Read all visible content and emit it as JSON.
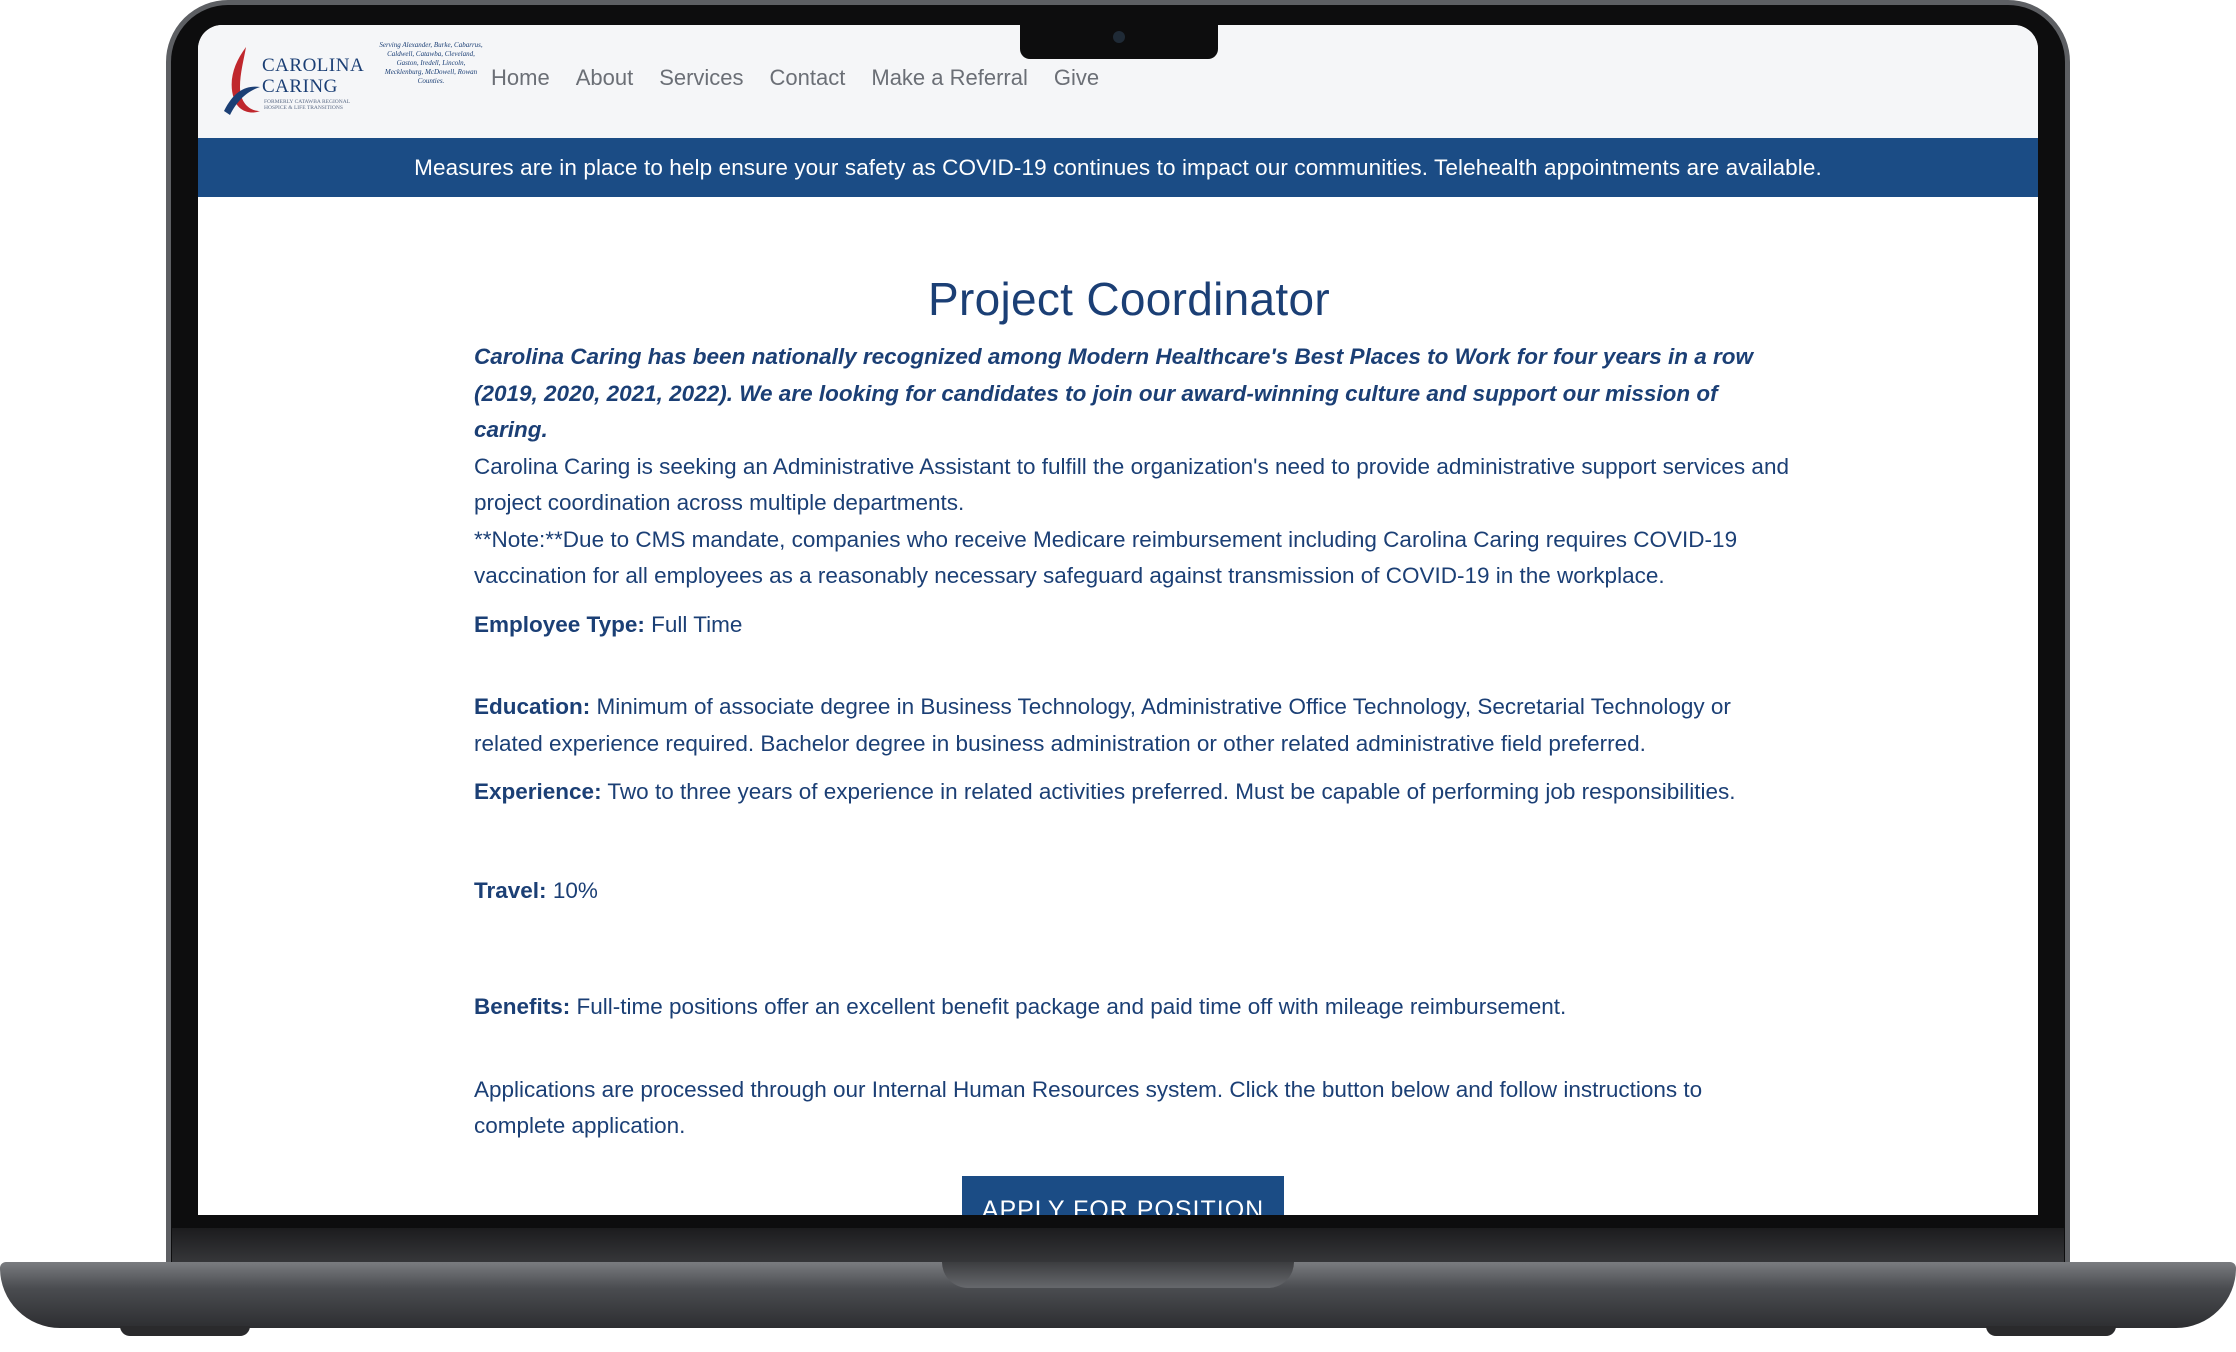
{
  "site": {
    "logo": {
      "name_line1": "CAROLINA",
      "name_line2": "CARING",
      "tagline": "FORMERLY CATAWBA REGIONAL HOSPICE & LIFE TRANSITIONS",
      "counties": "Serving Alexander, Burke, Cabarrus, Caldwell, Catawba, Cleveland, Gaston, Iredell, Lincoln, Mecklenburg, McDowell, Rowan Counties."
    },
    "nav": [
      "Home",
      "About",
      "Services",
      "Contact",
      "Make a Referral",
      "Give"
    ],
    "banner": "Measures are in place to help ensure your safety as COVID-19 continues to impact our communities. Telehealth appointments are available."
  },
  "job": {
    "title": "Project Coordinator",
    "lead": "Carolina Caring has been nationally recognized among Modern Healthcare's Best Places to Work for four years in a row (2019, 2020, 2021, 2022). We are looking for candidates to join our award-winning culture and support our mission of caring.",
    "summary": "Carolina Caring is seeking an Administrative Assistant to fulfill the organization's need to provide administrative support services and project coordination across multiple departments.",
    "note": "**Note:**Due to CMS mandate, companies who receive Medicare reimbursement including Carolina Caring requires COVID-19 vaccination for all employees as a reasonably necessary safeguard against transmission of COVID-19 in the workplace.",
    "employee_type_label": "Employee Type:",
    "employee_type": "Full Time",
    "education_label": "Education:",
    "education": "Minimum of associate degree in Business Technology, Administrative Office Technology, Secretarial Technology or related experience required. Bachelor degree in business administration or other related administrative field preferred.",
    "experience_label": "Experience:",
    "experience": "Two to three years of experience in related activities preferred.  Must be capable of performing job responsibilities.",
    "travel_label": "Travel:",
    "travel": "10%",
    "benefits_label": "Benefits:",
    "benefits": "Full-time positions offer an excellent benefit package and paid time off with mileage reimbursement.",
    "apply_text": "Applications are processed through our Internal Human Resources system. Click the button below and follow instructions to complete application.",
    "apply_button": "APPLY FOR POSITION"
  },
  "colors": {
    "brand_blue": "#1b4c85",
    "text_blue": "#1b3f75",
    "logo_red": "#c0272d"
  }
}
